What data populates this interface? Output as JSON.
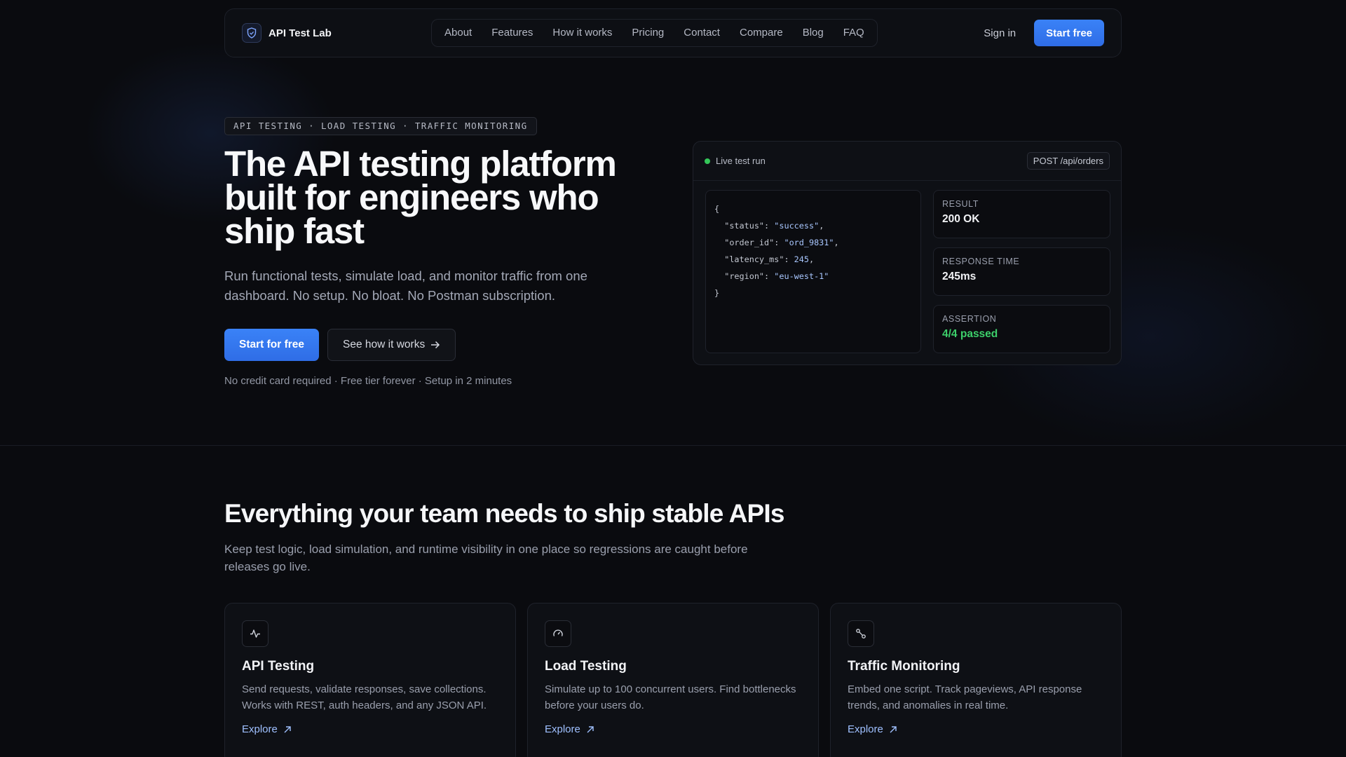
{
  "brand": {
    "name": "API Test Lab"
  },
  "nav": {
    "links": [
      "About",
      "Features",
      "How it works",
      "Pricing",
      "Contact",
      "Compare",
      "Blog",
      "FAQ"
    ],
    "signin": "Sign in",
    "cta": "Start free"
  },
  "hero": {
    "pill": "API TESTING · LOAD TESTING · TRAFFIC MONITORING",
    "title": "The API testing platform built for engineers who ship fast",
    "subtitle": "Run functional tests, simulate load, and monitor traffic from one dashboard. No setup. No bloat. No Postman subscription.",
    "primary_cta": "Start for free",
    "secondary_cta": "See how it works",
    "note": "No credit card required · Free tier forever · Setup in 2 minutes"
  },
  "live": {
    "label": "Live test run",
    "endpoint": "POST /api/orders",
    "code": {
      "open": "{",
      "close": "}",
      "lines": [
        {
          "key": "\"status\"",
          "value": "\"success\"",
          "trail": ","
        },
        {
          "key": "\"order_id\"",
          "value": "\"ord_9831\"",
          "trail": ","
        },
        {
          "key": "\"latency_ms\"",
          "value": "245",
          "trail": ","
        },
        {
          "key": "\"region\"",
          "value": "\"eu-west-1\"",
          "trail": ""
        }
      ]
    },
    "metrics": [
      {
        "label": "RESULT",
        "value": "200 OK"
      },
      {
        "label": "RESPONSE TIME",
        "value": "245ms"
      },
      {
        "label": "ASSERTION",
        "value": "4/4 passed"
      }
    ]
  },
  "features": {
    "title": "Everything your team needs to ship stable APIs",
    "subtitle": "Keep test logic, load simulation, and runtime visibility in one place so regressions are caught before releases go live.",
    "cards": [
      {
        "title": "API Testing",
        "desc": "Send requests, validate responses, save collections. Works with REST, auth headers, and any JSON API.",
        "link": "Explore",
        "icon": "activity-icon"
      },
      {
        "title": "Load Testing",
        "desc": "Simulate up to 100 concurrent users. Find bottlenecks before your users do.",
        "link": "Explore",
        "icon": "gauge-icon"
      },
      {
        "title": "Traffic Monitoring",
        "desc": "Embed one script. Track pageviews, API response trends, and anomalies in real time.",
        "link": "Explore",
        "icon": "route-icon"
      }
    ]
  },
  "colors": {
    "accent": "#3a82f7",
    "success": "#3ccf6a",
    "background": "#0a0b0f"
  }
}
